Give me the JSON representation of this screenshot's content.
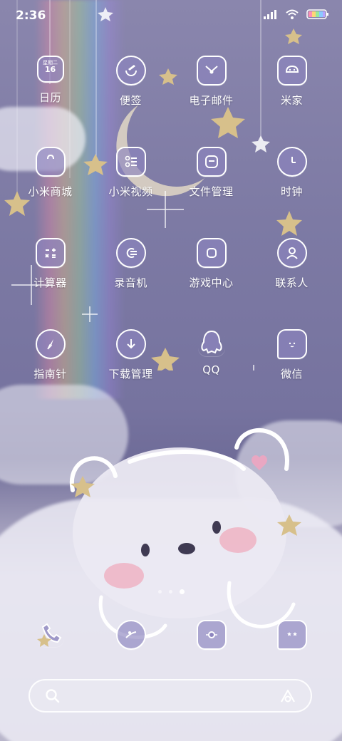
{
  "status": {
    "time": "2:36"
  },
  "apps": [
    {
      "label": "日历",
      "icon": "calendar-icon",
      "badge_top": "星期二",
      "badge_num": "16"
    },
    {
      "label": "便签",
      "icon": "notes-icon"
    },
    {
      "label": "电子邮件",
      "icon": "mail-icon"
    },
    {
      "label": "米家",
      "icon": "mijia-icon"
    },
    {
      "label": "小米商城",
      "icon": "shopping-bag-icon"
    },
    {
      "label": "小米视频",
      "icon": "video-icon"
    },
    {
      "label": "文件管理",
      "icon": "file-manager-icon"
    },
    {
      "label": "时钟",
      "icon": "clock-icon"
    },
    {
      "label": "计算器",
      "icon": "calculator-icon"
    },
    {
      "label": "录音机",
      "icon": "recorder-icon"
    },
    {
      "label": "游戏中心",
      "icon": "game-center-icon"
    },
    {
      "label": "联系人",
      "icon": "contacts-icon"
    },
    {
      "label": "指南针",
      "icon": "compass-icon"
    },
    {
      "label": "下载管理",
      "icon": "download-icon"
    },
    {
      "label": "QQ",
      "icon": "qq-icon"
    },
    {
      "label": "微信",
      "icon": "wechat-icon"
    }
  ],
  "dock": [
    {
      "icon": "phone-icon"
    },
    {
      "icon": "browser-icon"
    },
    {
      "icon": "camera-icon"
    },
    {
      "icon": "messages-icon"
    }
  ],
  "page_indicator": {
    "pages": 3,
    "active": 3
  },
  "colors": {
    "icon_fill": "#8c84be",
    "icon_stroke": "#ffffff"
  }
}
